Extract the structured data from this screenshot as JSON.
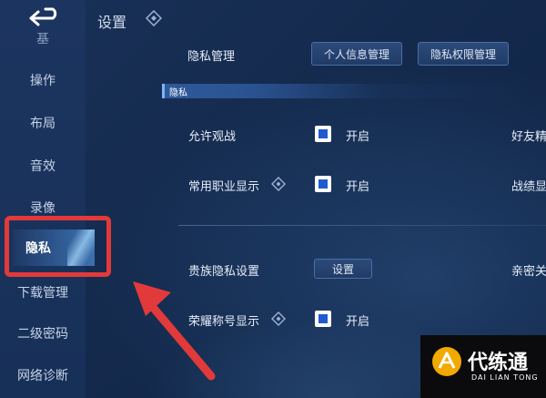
{
  "header": {
    "title": "设置"
  },
  "sidebar": {
    "items": [
      {
        "label": "操作"
      },
      {
        "label": "布局"
      },
      {
        "label": "音效"
      },
      {
        "label": "录像"
      },
      {
        "label": "隐私"
      },
      {
        "label": "下载管理"
      },
      {
        "label": "二级密码"
      },
      {
        "label": "网络诊断"
      }
    ],
    "partial_top_label": "基",
    "active_item": "隐私"
  },
  "privacy_management": {
    "label": "隐私管理",
    "buttons": [
      "个人信息管理",
      "隐私权限管理"
    ]
  },
  "section": {
    "title": "隐私"
  },
  "rows": {
    "allow_spectate": {
      "label": "允许观战",
      "checkbox_label": "开启",
      "checked": true
    },
    "common_role_display": {
      "label": "常用职业显示",
      "checkbox_label": "开启",
      "checked": true
    },
    "noble_privacy": {
      "label": "贵族隐私设置",
      "button": "设置"
    },
    "honor_title_display": {
      "label": "荣耀称号显示",
      "checkbox_label": "开启",
      "checked": true
    }
  },
  "right_column_cut": {
    "friend": "好友精",
    "record": "战绩显",
    "intimate": "亲密关"
  },
  "watermark": {
    "title": "代练通",
    "subtitle": "DAI LIAN TONG"
  },
  "colors": {
    "background": "#142a4d",
    "highlight_box": "#e23a3a",
    "checkbox_fill": "#1f5bd0",
    "arrow": "#e23a3a"
  }
}
